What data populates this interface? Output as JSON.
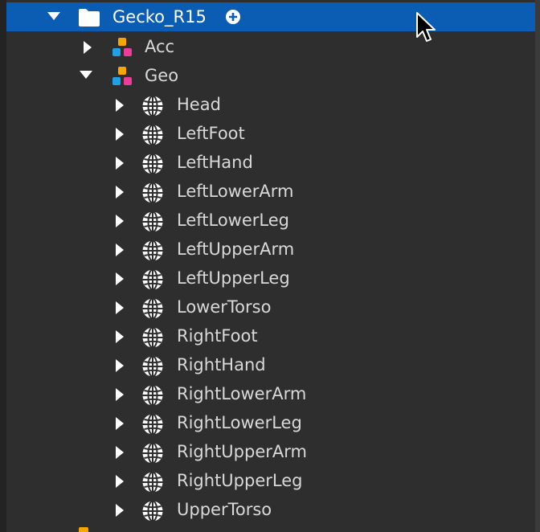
{
  "tree": {
    "root": {
      "label": "Gecko_R15",
      "expanded": true,
      "selected": true,
      "icon": "folder-icon",
      "action_icon": "add-icon"
    },
    "children": [
      {
        "label": "Acc",
        "expanded": false,
        "icon": "model-icon"
      },
      {
        "label": "Geo",
        "expanded": true,
        "icon": "model-icon"
      }
    ],
    "geo_children": [
      {
        "label": "Head",
        "icon": "globe-icon"
      },
      {
        "label": "LeftFoot",
        "icon": "globe-icon"
      },
      {
        "label": "LeftHand",
        "icon": "globe-icon"
      },
      {
        "label": "LeftLowerArm",
        "icon": "globe-icon"
      },
      {
        "label": "LeftLowerLeg",
        "icon": "globe-icon"
      },
      {
        "label": "LeftUpperArm",
        "icon": "globe-icon"
      },
      {
        "label": "LeftUpperLeg",
        "icon": "globe-icon"
      },
      {
        "label": "LowerTorso",
        "icon": "globe-icon"
      },
      {
        "label": "RightFoot",
        "icon": "globe-icon"
      },
      {
        "label": "RightHand",
        "icon": "globe-icon"
      },
      {
        "label": "RightLowerArm",
        "icon": "globe-icon"
      },
      {
        "label": "RightLowerLeg",
        "icon": "globe-icon"
      },
      {
        "label": "RightUpperArm",
        "icon": "globe-icon"
      },
      {
        "label": "RightUpperLeg",
        "icon": "globe-icon"
      },
      {
        "label": "UpperTorso",
        "icon": "globe-icon"
      }
    ]
  },
  "colors": {
    "background": "#2e2e2e",
    "selection": "#0b5cb3",
    "text": "#d9d9d9",
    "model_orange": "#f7a600",
    "model_blue": "#1ea1e6",
    "model_pink": "#ee3c9b"
  }
}
